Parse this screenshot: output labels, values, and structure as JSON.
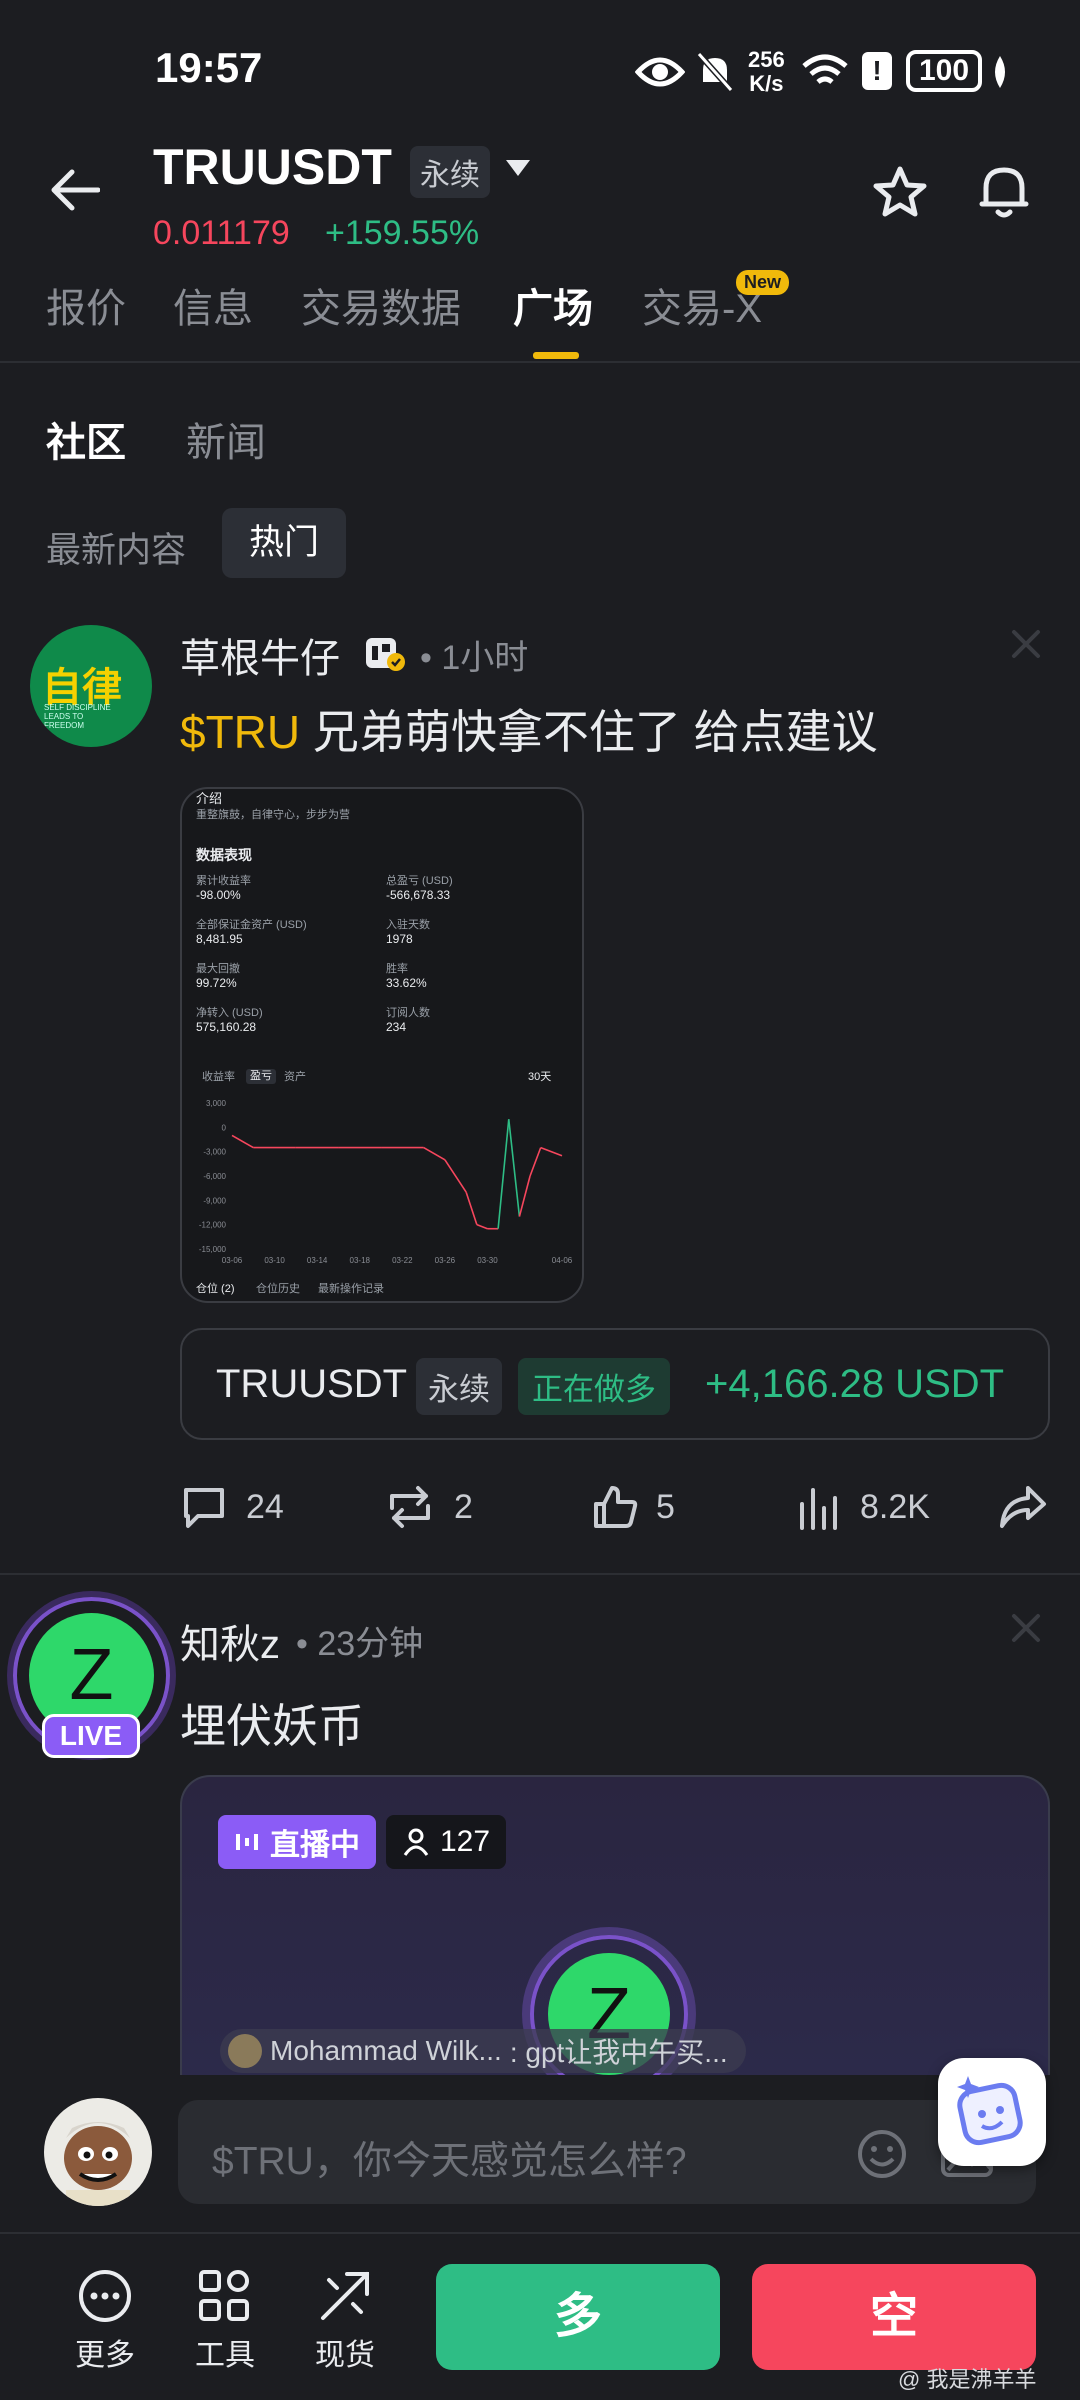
{
  "status_bar": {
    "time": "19:57",
    "net_speed_top": "256",
    "net_speed_bottom": "K/s",
    "battery": "100"
  },
  "header": {
    "symbol": "TRUUSDT",
    "contract_type": "永续",
    "price": "0.011179",
    "change": "+159.55%"
  },
  "tabs": [
    {
      "label": "报价"
    },
    {
      "label": "信息"
    },
    {
      "label": "交易数据"
    },
    {
      "label": "广场"
    },
    {
      "label": "交易-X",
      "badge": "New"
    }
  ],
  "sub_tabs": [
    {
      "label": "社区"
    },
    {
      "label": "新闻"
    }
  ],
  "filters": [
    {
      "label": "最新内容"
    },
    {
      "label": "热门"
    }
  ],
  "post1": {
    "avatar_text": "自律",
    "avatar_sub": "SELF DISCIPLINE LEADS TO FREEDOM",
    "author": "草根牛仔",
    "time": "1小时",
    "title_ticker": "$TRU",
    "title_text": " 兄弟萌快拿不住了 给点建议",
    "image": {
      "header": "介绍",
      "intro": "重整旗鼓，自律守心，步步为营",
      "section_title": "数据表现",
      "stats": [
        {
          "label": "累计收益率",
          "value": "-98.00%"
        },
        {
          "label": "总盈亏 (USD)",
          "value": "-566,678.33"
        },
        {
          "label": "全部保证金资产 (USD)",
          "value": "8,481.95"
        },
        {
          "label": "入驻天数",
          "value": "1978"
        },
        {
          "label": "最大回撤",
          "value": "99.72%"
        },
        {
          "label": "胜率",
          "value": "33.62%"
        },
        {
          "label": "净转入 (USD)",
          "value": "575,160.28"
        },
        {
          "label": "订阅人数",
          "value": "234"
        }
      ],
      "chart_tabs": [
        "收益率",
        "盈亏",
        "资产"
      ],
      "range": "30天",
      "footer_tabs": [
        "仓位 (2)",
        "仓位历史",
        "最新操作记录"
      ]
    },
    "position": {
      "symbol": "TRUUSDT",
      "type": "永续",
      "side": "正在做多",
      "pnl": "+4,166.28 USDT"
    },
    "actions": {
      "comments": "24",
      "reposts": "2",
      "likes": "5",
      "views": "8.2K"
    }
  },
  "post2": {
    "avatar_letter": "Z",
    "live_badge": "LIVE",
    "author": "知秋z",
    "time": "23分钟",
    "title": "埋伏妖币",
    "live_label": "直播中",
    "viewers": "127",
    "chat_user": "Mohammad Wilk...",
    "chat_text": ": gpt让我中午买..."
  },
  "composer": {
    "placeholder": "$TRU，你今天感觉怎么样?"
  },
  "bottom_nav": {
    "more": "更多",
    "tools": "工具",
    "spot": "现货",
    "long": "多",
    "short": "空"
  },
  "watermark": "@ 我是沸羊羊",
  "chart_data": {
    "type": "line",
    "title": "",
    "xlabel": "",
    "ylabel": "",
    "x": [
      "03-06",
      "03-10",
      "03-14",
      "03-18",
      "03-22",
      "03-26",
      "03-30",
      "04-06"
    ],
    "y_ticks": [
      "3,000",
      "0",
      "-3,000",
      "-6,000",
      "-9,000",
      "-12,000",
      "-15,000"
    ],
    "ylim": [
      -15000,
      3000
    ],
    "series": [
      {
        "x": [
          "03-06",
          "03-08",
          "03-12",
          "03-16",
          "03-20",
          "03-24",
          "03-26",
          "03-28",
          "03-29",
          "03-30",
          "03-31",
          "04-01",
          "04-02",
          "04-03",
          "04-04",
          "04-06"
        ],
        "values": [
          -1000,
          -2500,
          -2500,
          -2500,
          -2500,
          -2500,
          -4000,
          -8000,
          -12000,
          -12500,
          -12500,
          1000,
          -11000,
          -6000,
          -2500,
          -3500
        ]
      }
    ]
  }
}
